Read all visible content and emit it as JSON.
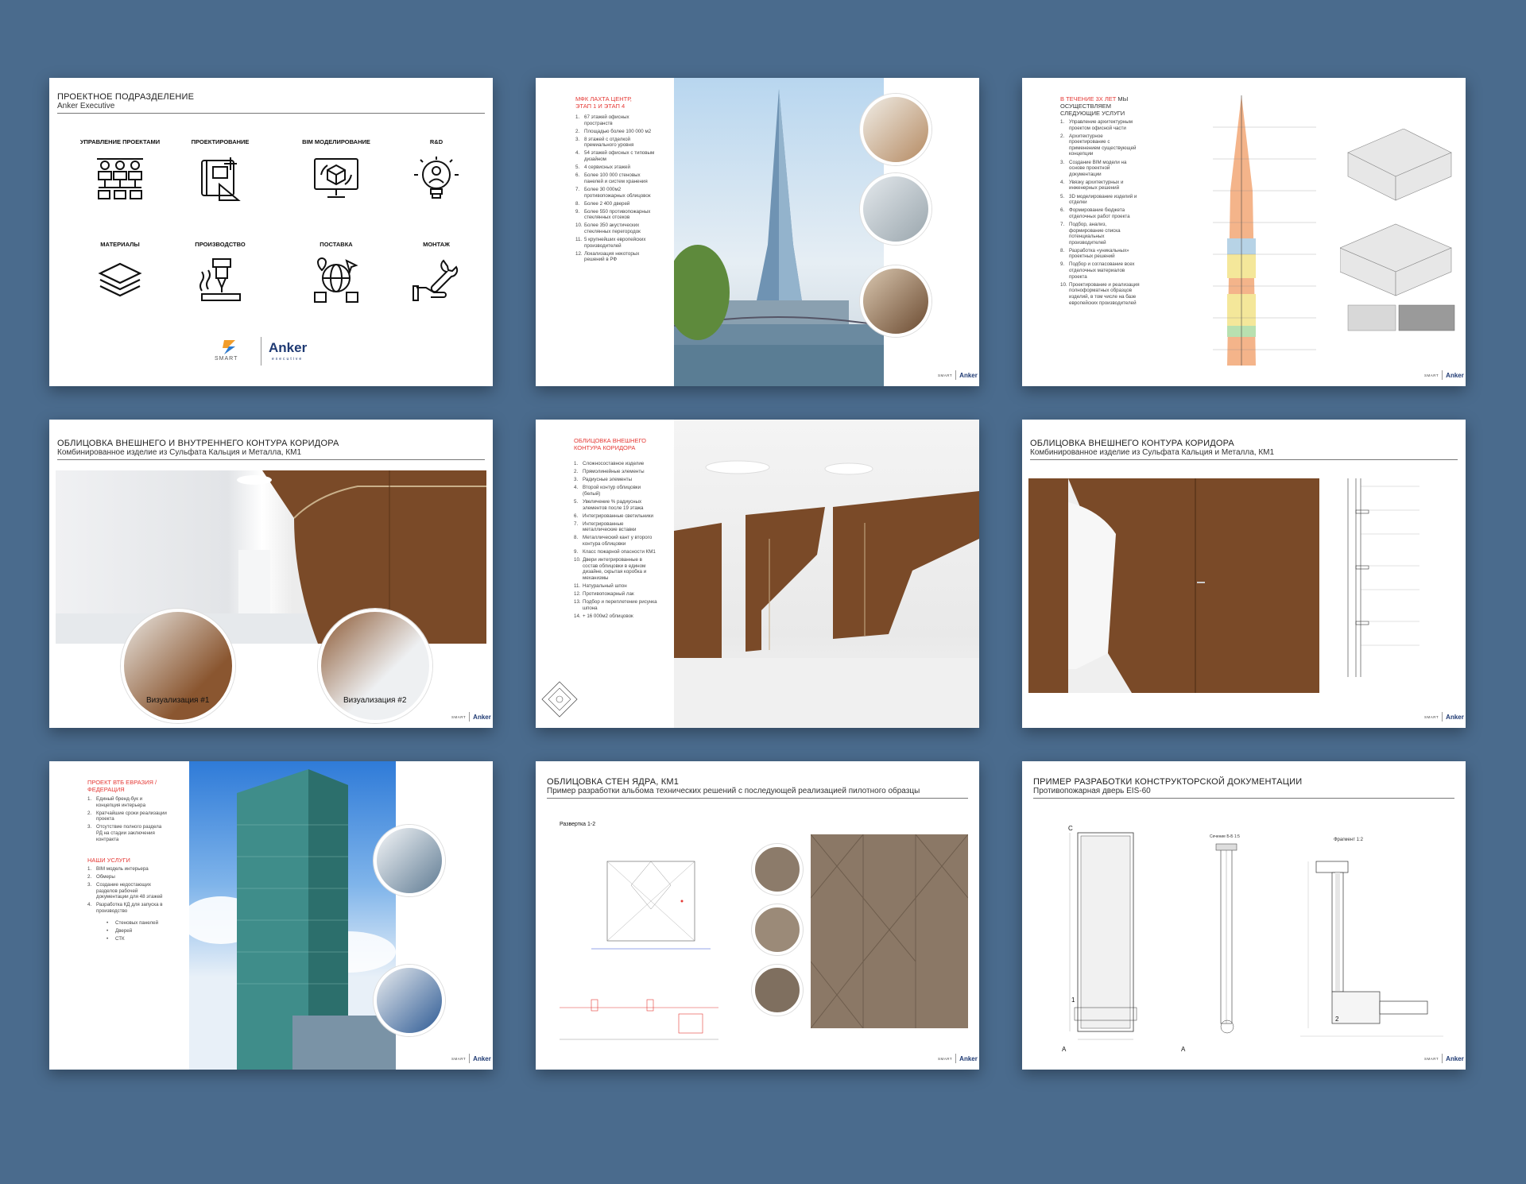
{
  "slide1": {
    "title": "ПРОЕКТНОЕ ПОДРАЗДЕЛЕНИЕ",
    "subtitle": "Anker Executive",
    "categories": [
      {
        "label": "УПРАВЛЕНИЕ ПРОЕКТАМИ",
        "icon": "team-hierarchy-icon"
      },
      {
        "label": "ПРОЕКТИРОВАНИЕ",
        "icon": "blueprint-icon"
      },
      {
        "label": "BIM МОДЕЛИРОВАНИЕ",
        "icon": "monitor-cube-icon"
      },
      {
        "label": "R&D",
        "icon": "lightbulb-person-icon"
      },
      {
        "label": "МАТЕРИАЛЫ",
        "icon": "layers-icon"
      },
      {
        "label": "ПРОИЗВОДСТВО",
        "icon": "drill-icon"
      },
      {
        "label": "ПОСТАВКА",
        "icon": "globe-delivery-icon"
      },
      {
        "label": "МОНТАЖ",
        "icon": "hand-wrench-icon"
      }
    ],
    "logo_smart": "SMART",
    "logo_anker": "Anker",
    "logo_anker_sub": "executive"
  },
  "slide2": {
    "heading": "МФК ЛАХТА ЦЕНТР, ЭТАП 1 И ЭТАП 4",
    "items": [
      "67 этажей офисных пространств",
      "Площадью более 100 000 м2",
      "8 этажей с отделкой премиального уровня",
      "54 этажей офисных с типовым дизайном",
      "4 сервисных этажей",
      "Более 100 000 стеновых панелей и систем хранения",
      "Более 30 000м2 противопожарных облицовок",
      "Более 2 400 дверей",
      "Более 550 противопожарных стеклянных отсеков",
      "Более 350 акустических стеклянных перегородок",
      "5 крупнейших европейских производителей",
      "Локализация некоторых решений в РФ"
    ]
  },
  "slide3": {
    "heading_red": "В ТЕЧЕНИЕ 3Х ЛЕТ",
    "heading_rest": "МЫ ОСУЩЕСТВЛЯЕМ СЛЕДУЮЩИЕ УСЛУГИ",
    "items": [
      "Управление архитектурным проектом офисной части",
      "Архитектурное проектирование с применением существующей концепции",
      "Создание BIM модели на основе проектной документации",
      "Увязку архитектурных и инженерных решений",
      "3D моделирование изделий и отделки",
      "Формирование бюджета отделочных работ проекта",
      "Подбор, анализ, формирование списка потенциальных производителей",
      "Разработка «уникальных» проектных решений",
      "Подбор и согласование всех отделочных материалов проекта",
      "Проектирование и реализация полноформатных образцов изделий, в том числе на базе европейских производителей"
    ]
  },
  "slide4": {
    "title": "ОБЛИЦОВКА ВНЕШНЕГО И ВНУТРЕННЕГО КОНТУРА КОРИДОРА",
    "subtitle": "Комбинированное изделие из Сульфата Кальция и Металла, КМ1",
    "viz1": "Визуализация #1",
    "viz2": "Визуализация #2"
  },
  "slide5": {
    "heading": "ОБЛИЦОВКА ВНЕШНЕГО КОНТУРА КОРИДОРА",
    "items": [
      "Сложносоставное изделие",
      "Прямолинейные элементы",
      "Радиусные элементы",
      "Второй контур облицовки (белый)",
      "Увеличение % радиусных элементов после 19 этажа",
      "Интегрированные светильники",
      "Интегрированные металлические вставки",
      "Металлический кант у второго контура облицовки",
      "Класс пожарной опасности КМ1",
      "Двери интегрированные в состав облицовки в едином дизайне, скрытая коробка и механизмы",
      "Натуральный шпон",
      "Противопожарный лак",
      "Подбор и переплетение рисунка шпона",
      "+ 16 000м2 облицовок"
    ]
  },
  "slide6": {
    "title": "ОБЛИЦОВКА ВНЕШНЕГО КОНТУРА КОРИДОРА",
    "subtitle": "Комбинированное изделие из Сульфата Кальция и Металла, КМ1"
  },
  "slide7": {
    "heading1": "ПРОЕКТ ВТБ ЕВРАЗИЯ / ФЕДЕРАЦИЯ",
    "items1": [
      "Единый бренд-бук и концепция интерьера",
      "Кратчайшие сроки реализации проекта",
      "Отсутствие полного раздела РД на стадии заключения контракта"
    ],
    "heading2": "НАШИ УСЛУГИ",
    "items2": [
      "BIM модель интерьера",
      "Обмеры",
      "Создание недостающих разделов рабочей документации для 48 этажей",
      "Разработка КД для запуска в производство"
    ],
    "subitems": [
      "Стеновых панелей",
      "Дверей",
      "СТК"
    ]
  },
  "slide8": {
    "title": "ОБЛИЦОВКА СТЕН ЯДРА, КМ1",
    "subtitle": "Пример разработки альбома технических решений с последующей реализацией пилотного образцы",
    "drawing_label": "Развертка 1-2"
  },
  "slide9": {
    "title": "ПРИМЕР РАЗРАБОТКИ КОНСТРУКТОРСКОЙ ДОКУМЕНТАЦИИ",
    "subtitle": "Противопожарная дверь EIS-60",
    "labels": {
      "a_top": "А",
      "c_top": "С",
      "section": "Сечение Б-Б 1:5",
      "fragment": "Фрагмент 1:2",
      "num1": "1",
      "num2": "2"
    }
  },
  "brand": {
    "smart": "SMART",
    "anker": "Anker"
  },
  "colors": {
    "background": "#4a6b8d",
    "accent_red": "#e53935",
    "anker_blue": "#1f3a73",
    "wood": "#7a4a28"
  }
}
